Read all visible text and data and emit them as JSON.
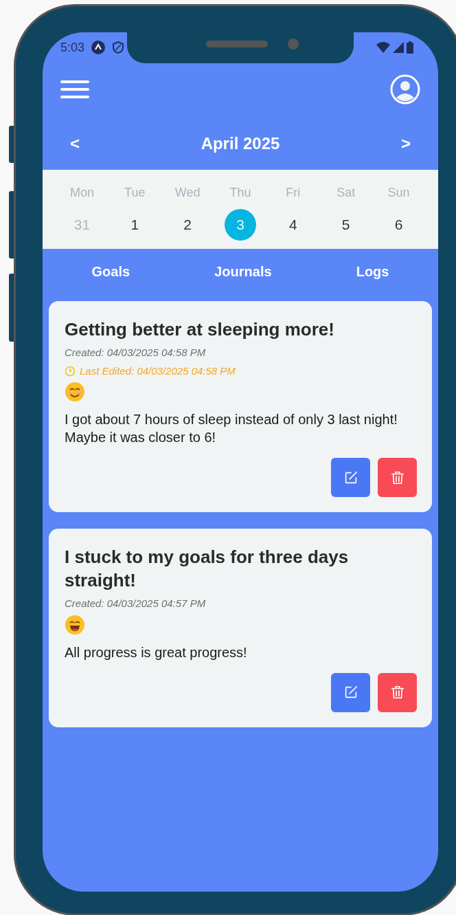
{
  "status_bar": {
    "time": "5:03"
  },
  "month_nav": {
    "prev": "<",
    "title": "April 2025",
    "next": ">"
  },
  "week": [
    {
      "weekday": "Mon",
      "day": "31",
      "muted": true,
      "selected": false
    },
    {
      "weekday": "Tue",
      "day": "1",
      "muted": false,
      "selected": false
    },
    {
      "weekday": "Wed",
      "day": "2",
      "muted": false,
      "selected": false
    },
    {
      "weekday": "Thu",
      "day": "3",
      "muted": false,
      "selected": true
    },
    {
      "weekday": "Fri",
      "day": "4",
      "muted": false,
      "selected": false
    },
    {
      "weekday": "Sat",
      "day": "5",
      "muted": false,
      "selected": false
    },
    {
      "weekday": "Sun",
      "day": "6",
      "muted": false,
      "selected": false
    }
  ],
  "tabs": [
    {
      "label": "Goals"
    },
    {
      "label": "Journals"
    },
    {
      "label": "Logs"
    }
  ],
  "entries": [
    {
      "title": "Getting better at sleeping more!",
      "created": "Created: 04/03/2025 04:58 PM",
      "last_edited": "Last Edited: 04/03/2025 04:58 PM",
      "kind": "smiling",
      "body": [
        "I got about 7 hours of sleep instead of only 3 last night!",
        "Maybe it was closer to 6!"
      ]
    },
    {
      "title": "I stuck to my goals for three days straight!",
      "created": "Created: 04/03/2025 04:57 PM",
      "kind": "grinning",
      "body": [
        "All progress is great progress!"
      ]
    }
  ]
}
